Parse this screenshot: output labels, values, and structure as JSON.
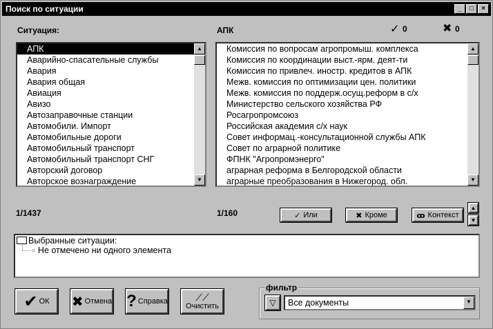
{
  "window": {
    "title": "Поиск по ситуации",
    "buttons": {
      "minimize": "_",
      "maximize": "□",
      "close": "×"
    }
  },
  "situation_label": "Ситуация:",
  "current_situation": "АПК",
  "counts": {
    "yes": "0",
    "no": "0"
  },
  "left_list": {
    "items": [
      "АПК",
      "Аварийно-спасательные службы",
      "Авария",
      "Авария общая",
      "Авиация",
      "Авизо",
      "Автозаправочные станции",
      "Автомобили. Импорт",
      "Автомобильные дороги",
      "Автомобильный транспорт",
      "Автомобильный транспорт СНГ",
      "Авторский договор",
      "Авторское вознаграждение"
    ],
    "selected_index": 0,
    "position": "1/1437"
  },
  "right_list": {
    "items": [
      "Комиссия по вопросам агропромыш. комплекса",
      "Комиссия по координации выст.-ярм. деят-ти",
      "Комиссия по привлеч. иностр. кредитов в АПК",
      "Межв. комиссия по оптимизации цен. политики",
      "Межв. комиссия по поддерж.осущ.реформ в с/х",
      "Министерство сельского хозяйства РФ",
      "Росагропромсоюз",
      "Российская академия с/х наук",
      "Совет информац.-консультационной службы АПК",
      "Совет по аграрной политике",
      "ФПНК \"Агропромэнерго\"",
      "аграрная реформа в Белгородской области",
      "аграрные преобразования в Нижегород. обл."
    ],
    "position": "1/160"
  },
  "buttons": {
    "or": "Или",
    "except": "Кроме",
    "context": "Контекст",
    "ok": "ОК",
    "cancel": "Отмена",
    "help": "Справка",
    "clear": "Очистить"
  },
  "selected": {
    "header": "Выбранные ситуации:",
    "empty_text": "Не отмечено ни одного элемента"
  },
  "filter": {
    "label": "фильтр",
    "value": "Все документы"
  }
}
